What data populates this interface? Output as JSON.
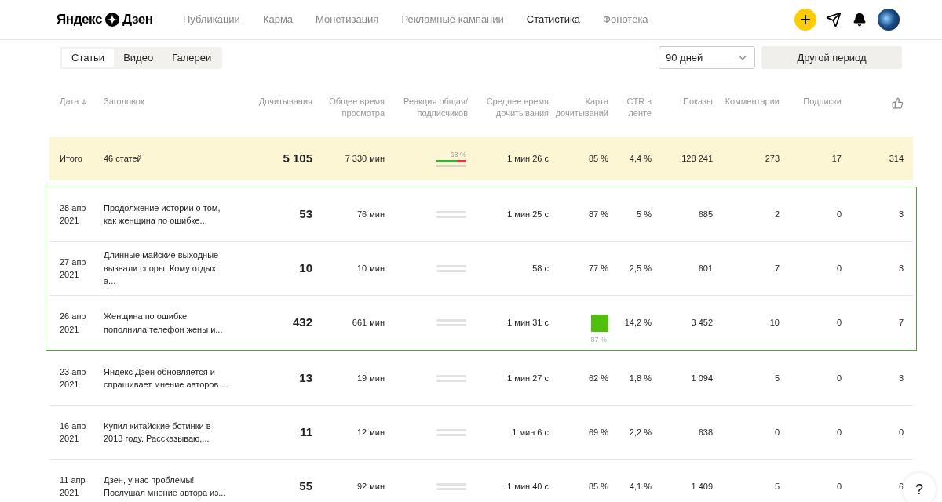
{
  "logo": {
    "left": "Яндекс",
    "right": "Дзен"
  },
  "nav": [
    {
      "label": "Публикации",
      "selected": false
    },
    {
      "label": "Карма",
      "selected": false
    },
    {
      "label": "Монетизация",
      "selected": false
    },
    {
      "label": "Рекламные кампании",
      "selected": false
    },
    {
      "label": "Статистика",
      "selected": true
    },
    {
      "label": "Фонотека",
      "selected": false
    }
  ],
  "content_tabs": [
    {
      "label": "Статьи",
      "selected": true
    },
    {
      "label": "Видео",
      "selected": false
    },
    {
      "label": "Галереи",
      "selected": false
    }
  ],
  "period_select": {
    "value": "90 дней"
  },
  "period_button": "Другой период",
  "table": {
    "columns": [
      "Дата",
      "Заголовок",
      "Дочитывания",
      "Общее время просмотра",
      "Реакция общая/ подписчиков",
      "Среднее время дочитывания",
      "Карта дочитываний",
      "CTR в ленте",
      "Показы",
      "Комментарии",
      "Подписки"
    ],
    "total": {
      "date": "Итого",
      "title": "46 статей",
      "reads": "5 105",
      "time": "7 330 мин",
      "reaction": {
        "kind": "bar",
        "label": "68 %",
        "level": 0.68
      },
      "avg_time": "1 мин 26 с",
      "card": {
        "kind": "text",
        "text": "85 %"
      },
      "ctr": "4,4 %",
      "shows": "128 241",
      "comments": "273",
      "subs": "17",
      "likes": "314"
    },
    "rows": [
      {
        "date": "28 апр 2021",
        "title": "Продолжение истории о том, как женщина по ошибке...",
        "reads": "53",
        "time": "76 мин",
        "reaction": {
          "kind": "empty"
        },
        "avg_time": "1 мин 25 с",
        "card": {
          "kind": "text",
          "text": "87 %"
        },
        "ctr": "5 %",
        "shows": "685",
        "comments": "2",
        "subs": "0",
        "likes": "3",
        "highlighted": true
      },
      {
        "date": "27 апр 2021",
        "title": "Длинные майские выходные вызвали споры. Кому отдых, а...",
        "reads": "10",
        "time": "10 мин",
        "reaction": {
          "kind": "empty"
        },
        "avg_time": "58 с",
        "card": {
          "kind": "text",
          "text": "77 %"
        },
        "ctr": "2,5 %",
        "shows": "601",
        "comments": "7",
        "subs": "0",
        "likes": "3",
        "highlighted": true
      },
      {
        "date": "26 апр 2021",
        "title": "Женщина по ошибке пополнила телефон жены и...",
        "reads": "432",
        "time": "661 мин",
        "reaction": {
          "kind": "empty"
        },
        "avg_time": "1 мин 31 с",
        "card": {
          "kind": "map",
          "text": "87 %",
          "color": "#4fc10a"
        },
        "ctr": "14,2 %",
        "shows": "3 452",
        "comments": "10",
        "subs": "0",
        "likes": "7",
        "highlighted": true
      },
      {
        "date": "23 апр 2021",
        "title": "Яндекс Дзен обновляется и спрашивает мнение авторов ...",
        "reads": "13",
        "time": "19 мин",
        "reaction": {
          "kind": "empty"
        },
        "avg_time": "1 мин 27 с",
        "card": {
          "kind": "text",
          "text": "62 %"
        },
        "ctr": "1,8 %",
        "shows": "1 094",
        "comments": "5",
        "subs": "0",
        "likes": "3",
        "highlighted": false
      },
      {
        "date": "16 апр 2021",
        "title": "Купил китайские ботинки в 2013 году. Рассказываю,...",
        "reads": "11",
        "time": "12 мин",
        "reaction": {
          "kind": "empty"
        },
        "avg_time": "1 мин 6 с",
        "card": {
          "kind": "text",
          "text": "69 %"
        },
        "ctr": "2,2 %",
        "shows": "638",
        "comments": "0",
        "subs": "0",
        "likes": "0",
        "highlighted": false
      },
      {
        "date": "11 апр 2021",
        "title": "Дзен, у нас проблемы! Послушал мнение автора из...",
        "reads": "55",
        "time": "92 мин",
        "reaction": {
          "kind": "empty"
        },
        "avg_time": "1 мин 40 с",
        "card": {
          "kind": "text",
          "text": "85 %"
        },
        "ctr": "4,1 %",
        "shows": "1 409",
        "comments": "5",
        "subs": "0",
        "likes": "6",
        "highlighted": false
      }
    ]
  },
  "help_button": "?"
}
